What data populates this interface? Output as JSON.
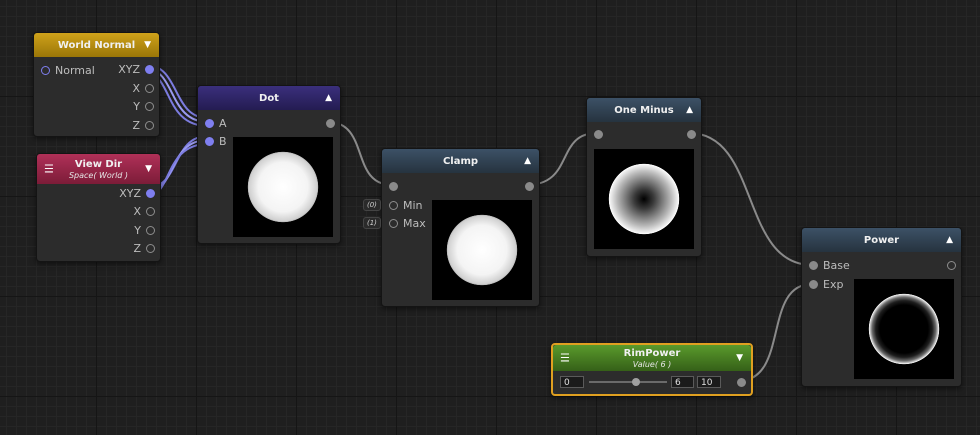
{
  "nodes": {
    "world_normal": {
      "title": "World Normal",
      "inputs": [
        "Normal"
      ],
      "outputs": [
        "XYZ",
        "X",
        "Y",
        "Z"
      ]
    },
    "view_dir": {
      "title": "View Dir",
      "subtitle": "Space( World )",
      "outputs": [
        "XYZ",
        "X",
        "Y",
        "Z"
      ]
    },
    "dot": {
      "title": "Dot",
      "inputs": [
        "A",
        "B"
      ]
    },
    "clamp": {
      "title": "Clamp",
      "inputs": [
        "Min",
        "Max"
      ],
      "defaults": [
        "(0)",
        "(1)"
      ]
    },
    "one_minus": {
      "title": "One Minus"
    },
    "power": {
      "title": "Power",
      "inputs": [
        "Base",
        "Exp"
      ]
    },
    "rim_power": {
      "title": "RimPower",
      "subtitle": "Value( 6 )",
      "min": "0",
      "value": "6",
      "max": "10",
      "slider_fraction": 0.6
    }
  },
  "icons": {
    "collapse": "triangle-up-icon",
    "expand": "triangle-down-icon",
    "menu": "hamburger-icon"
  },
  "colors": {
    "wire": "#8a8a8a",
    "vector_wire": "#9a9af0",
    "world_normal_header": "#cfa21a",
    "dot_header": "#3a2f7c",
    "view_dir_header": "#b03058",
    "math_header": "#3c5166",
    "property_header": "#5a9a2c",
    "selection": "#e0a020"
  }
}
